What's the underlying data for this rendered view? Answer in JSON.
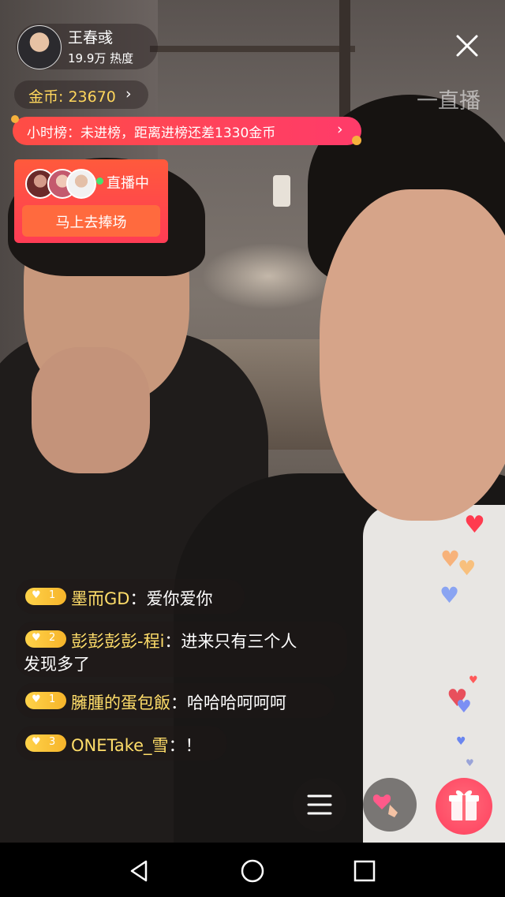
{
  "anchor": {
    "name": "王春彧",
    "heat": "19.9万 热度"
  },
  "watermark": "一直播",
  "coins": {
    "label": "金币: 23670",
    "chevron": "›"
  },
  "rank": {
    "text": "小时榜：未进榜，距离进榜还差1330金币",
    "chevron": "›"
  },
  "live_card": {
    "status": "直播中",
    "button": "马上去捧场"
  },
  "chat": [
    {
      "level": "1",
      "user": "墨而GD",
      "sep": "：",
      "message": "爱你爱你"
    },
    {
      "level": "2",
      "user": "彭彭彭彭-程i",
      "sep": "：",
      "message": "进来只有三个人",
      "message2": "发现多了"
    },
    {
      "level": "1",
      "user": "臃腫的蛋包飯",
      "sep": "：",
      "message": "哈哈哈呵呵呵"
    },
    {
      "level": "3",
      "user": "ONETake_雪",
      "sep": "：",
      "message": "！"
    }
  ],
  "icons": {
    "close": "close-icon",
    "menu": "menu-icon",
    "like": "heart-gesture-icon",
    "gift": "gift-icon",
    "back": "nav-back-icon",
    "home": "nav-home-icon",
    "recents": "nav-recents-icon"
  },
  "colors": {
    "accent": "#ff3f5e",
    "gold": "#ffd65c",
    "rank": "#ff4d45"
  }
}
